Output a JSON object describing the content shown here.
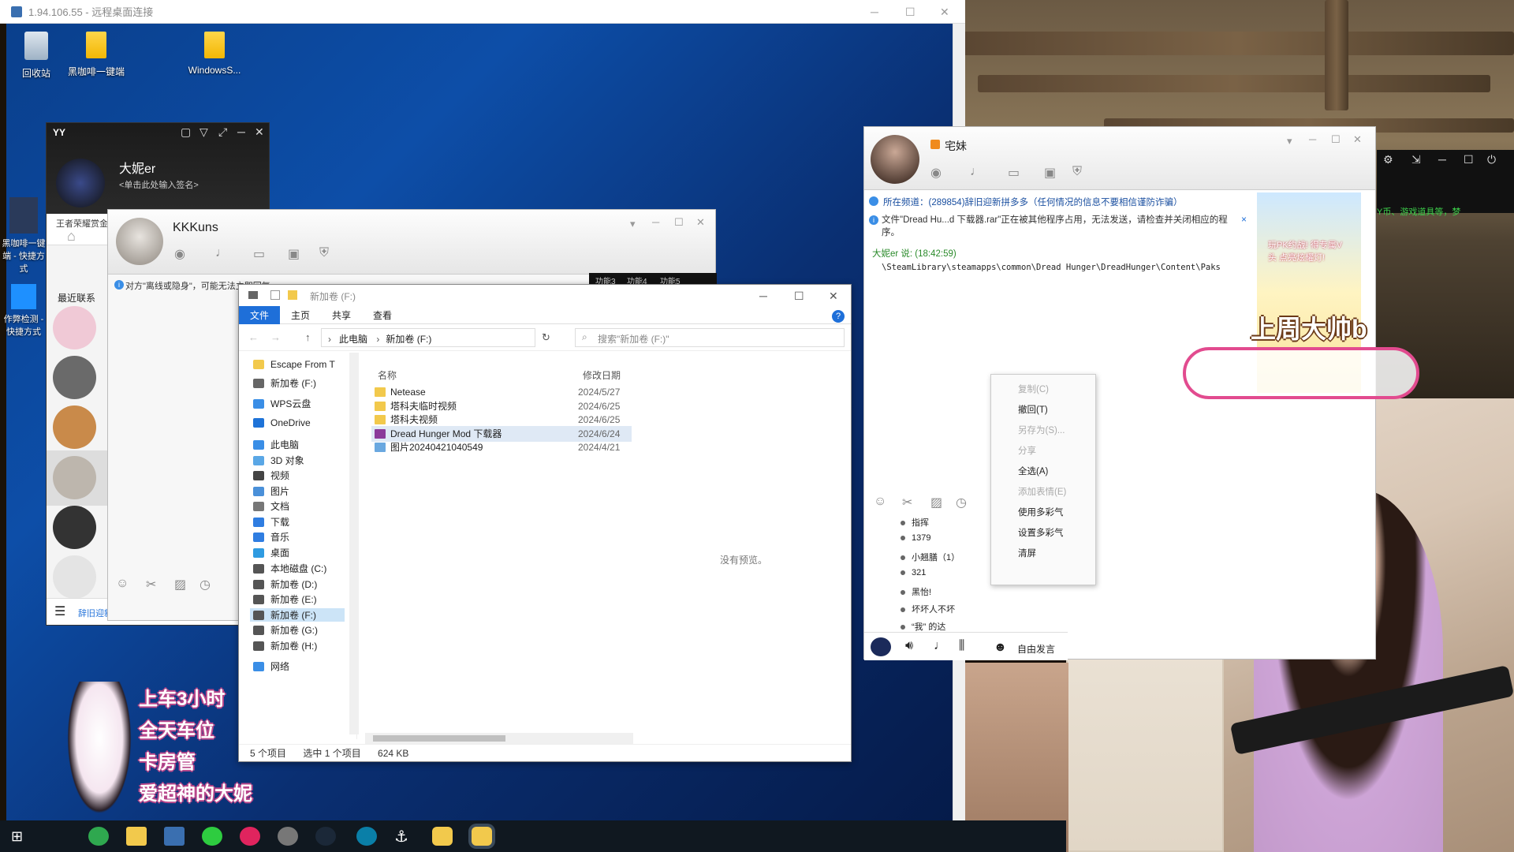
{
  "rdp": {
    "title": "1.94.106.55 - 远程桌面连接"
  },
  "desktop_icons": [
    {
      "label": "回收站"
    },
    {
      "label": "黑咖啡一键端"
    },
    {
      "label": "WindowsS..."
    }
  ],
  "side_desktop_icons": [
    {
      "label": "黑咖啡一键端 - 快捷方式"
    },
    {
      "label": "作弊检测 - 快捷方式"
    }
  ],
  "yy": {
    "logo": "YY",
    "name": "大妮er",
    "signature": "<单击此处输入签名>",
    "recent_label": "最近联系",
    "partial_text": "王者荣耀赏金",
    "bottom_status": "辞旧迎新拼多多（在..."
  },
  "kk_chat": {
    "name": "KKKuns",
    "notice": "对方\"离线或隐身\"，可能无法立即回复",
    "tabs": [
      "功能3",
      "功能4",
      "功能5"
    ]
  },
  "explorer": {
    "title": "新加卷 (F:)",
    "ribbon": [
      "文件",
      "主页",
      "共享",
      "查看"
    ],
    "breadcrumb": [
      "此电脑",
      "新加卷 (F:)"
    ],
    "search_placeholder": "搜索\"新加卷 (F:)\"",
    "col_name": "名称",
    "col_date": "修改日期",
    "nav": [
      {
        "label": "Escape From T",
        "icon": "folder-icon",
        "color": "#f2c94c"
      },
      {
        "label": "新加卷 (F:)",
        "icon": "drive-icon",
        "color": "#666666"
      },
      {
        "label": "WPS云盘",
        "icon": "cloud-icon",
        "color": "#3a8ee6"
      },
      {
        "label": "OneDrive",
        "icon": "cloud-icon",
        "color": "#1e73d8"
      },
      {
        "label": "此电脑",
        "icon": "pc-icon",
        "color": "#3a8ee6"
      },
      {
        "label": "3D 对象",
        "icon": "cube-icon",
        "color": "#5aa7e6"
      },
      {
        "label": "视频",
        "icon": "video-icon",
        "color": "#444444"
      },
      {
        "label": "图片",
        "icon": "image-icon",
        "color": "#4a90d9"
      },
      {
        "label": "文档",
        "icon": "document-icon",
        "color": "#777777"
      },
      {
        "label": "下载",
        "icon": "download-icon",
        "color": "#2f7de1"
      },
      {
        "label": "音乐",
        "icon": "music-icon",
        "color": "#2f7de1"
      },
      {
        "label": "桌面",
        "icon": "desktop-icon",
        "color": "#2f9be1"
      },
      {
        "label": "本地磁盘 (C:)",
        "icon": "drive-icon",
        "color": "#555555"
      },
      {
        "label": "新加卷 (D:)",
        "icon": "drive-icon",
        "color": "#555555"
      },
      {
        "label": "新加卷 (E:)",
        "icon": "drive-icon",
        "color": "#555555"
      },
      {
        "label": "新加卷 (F:)",
        "icon": "drive-icon",
        "color": "#555555"
      },
      {
        "label": "新加卷 (G:)",
        "icon": "drive-icon",
        "color": "#555555"
      },
      {
        "label": "新加卷 (H:)",
        "icon": "drive-icon",
        "color": "#555555"
      },
      {
        "label": "网络",
        "icon": "network-icon",
        "color": "#3a8ee6"
      }
    ],
    "files": [
      {
        "name": "Netease",
        "date": "2024/5/27",
        "icon": "folder-icon",
        "color": "#f2c94c"
      },
      {
        "name": "塔科夫临时视频",
        "date": "2024/6/25",
        "icon": "folder-icon",
        "color": "#f2c94c"
      },
      {
        "name": "塔科夫视频",
        "date": "2024/6/25",
        "icon": "folder-icon",
        "color": "#f2c94c"
      },
      {
        "name": "Dread Hunger Mod 下载器",
        "date": "2024/6/24",
        "icon": "archive-icon",
        "color": "#8b3a9a"
      },
      {
        "name": "图片20240421040549",
        "date": "2024/4/21",
        "icon": "image-file-icon",
        "color": "#6aa8e0"
      }
    ],
    "no_preview": "没有预览。",
    "status_count": "5 个项目",
    "status_selected": "选中 1 个项目",
    "status_size": "624 KB"
  },
  "zm_chat": {
    "name": "宅妹",
    "channel": "所在频道：(289854)辞旧迎新拼多多（任何情况的信息不要相信谨防诈骗）",
    "file_notice": "文件\"Dread Hu...d 下载器.rar\"正在被其他程序占用，无法发送，请检查并关闭相应的程序。",
    "sender": "大妮er 说: (18:42:59)",
    "message": "\\SteamLibrary\\steamapps\\common\\Dread Hunger\\DreadHunger\\Content\\Paks",
    "free_speak": "自由发言",
    "members": [
      "指挥",
      "1379",
      "小翘膳（1）",
      "321",
      "黑怡!",
      "坏坏人不坏",
      "“我” 的达"
    ]
  },
  "context_menu": [
    "复制(C)",
    "撤回(T)",
    "另存为(S)...",
    "分享",
    "全选(A)",
    "添加表情(E)",
    "使用多彩气",
    "设置多彩气",
    "清屏"
  ],
  "side_panel": {
    "text": "Y币、游戏道具等，梦"
  },
  "overlay": {
    "lines": [
      "上车3小时",
      "全天车位",
      "卡房管",
      "爱超神的大妮"
    ],
    "banner": "上周大帅b"
  },
  "ad": {
    "text": "玩PK约战! 得专属V头 点亮炫耀灯!"
  }
}
